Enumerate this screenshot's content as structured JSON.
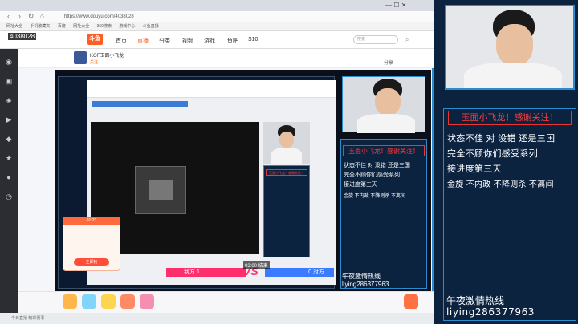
{
  "browser": {
    "url": "https://www.douyu.com/4038028",
    "bookmarks": [
      "网址大全",
      "手机收藏夹",
      "百度",
      "网址大全",
      "360搜索",
      "游戏中心",
      "斗鱼直播"
    ]
  },
  "header": {
    "room_id": "4038028",
    "logo": "斗鱼",
    "nav": [
      "首页",
      "直播",
      "分类",
      "视频",
      "游戏",
      "鱼吧",
      "S10"
    ],
    "search_placeholder": "搜索"
  },
  "room": {
    "title": "KOF玉面小飞龙",
    "tags": "关注",
    "share": "分享"
  },
  "inner_panel": {
    "title": "玉面小飞龙！感谢关注！"
  },
  "chat": {
    "title": "玉面小飞龙！感谢关注！",
    "lines": [
      "状态不佳  对  没错  还是三国",
      "完全不顾你们感受系列",
      "接进度第三天",
      "金旋  不内政  不降则杀  不离间"
    ],
    "hotline_label": "午夜激情热线",
    "hotline_id": "liying286377963"
  },
  "pk": {
    "left_label": "我方 1",
    "right_label": "0 对方",
    "vs": "VS",
    "timer": "03:00 结束"
  },
  "popup": {
    "head": "01:23",
    "button": "立即抢"
  },
  "right_panel": {
    "title": "玉面小飞龙！感谢关注！",
    "lines": [
      "状态不佳  对  没错  还是三国",
      "完全不顾你们感受系列",
      "接进度第三天",
      "金旋  不内政  不降则杀  不离间"
    ],
    "hotline_label": "午夜激情热线",
    "hotline_id": "liying286377963"
  },
  "statusbar": {
    "text": "今日直播  精彩赛事"
  },
  "colors": {
    "accent": "#2a8ccf",
    "douyu_orange": "#ff5d23",
    "panel_bg": "#0c2340",
    "title_red": "#ff3b3b"
  }
}
